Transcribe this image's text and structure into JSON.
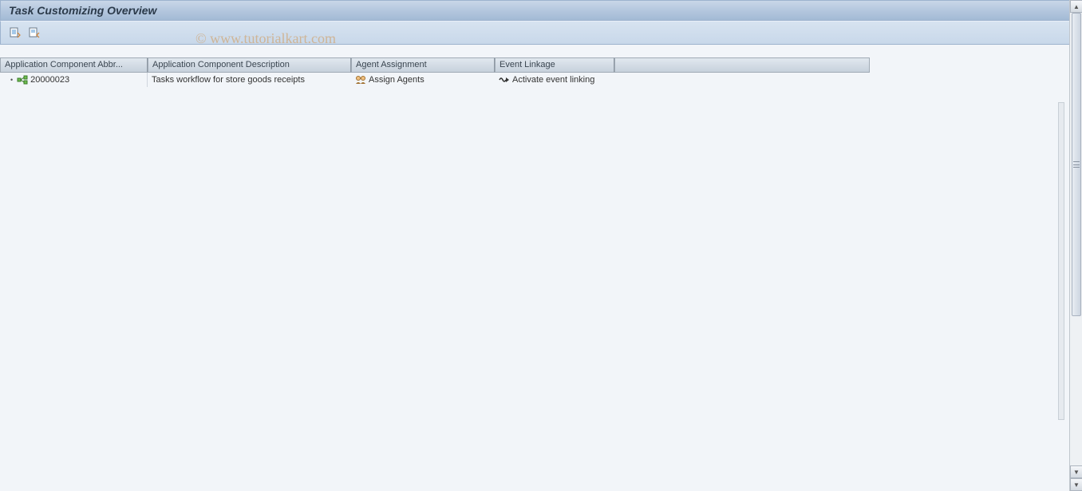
{
  "header": {
    "title": "Task Customizing Overview"
  },
  "columns": {
    "abbr": "Application Component Abbr...",
    "desc": "Application Component Description",
    "agent": "Agent Assignment",
    "event": "Event Linkage"
  },
  "row": {
    "abbr": "20000023",
    "desc": "Tasks workflow for store goods receipts",
    "agent": "Assign Agents",
    "event": "Activate event linking"
  },
  "watermark": "© www.tutorialkart.com"
}
